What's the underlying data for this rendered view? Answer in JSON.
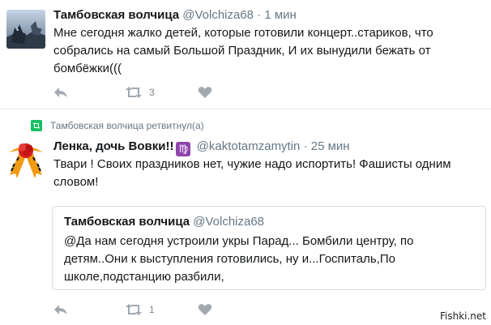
{
  "tweet1": {
    "name": "Тамбовская волчица",
    "handle": "@Volchiza68",
    "separator": "·",
    "time": "1 мин",
    "lines": [
      "Мне сегодня жалко детей, которые готовили концерт..стариков, что",
      "собрались на самый Большой Праздник, И их вынудили бежать от",
      "бомбёжки((("
    ],
    "retweets": "3"
  },
  "retweet_notice": "Тамбовская волчица ретвитнул(а)",
  "tweet2": {
    "name": "Ленка, дочь Вовки!!",
    "badge": "♍",
    "handle": "@kaktotamzamytin",
    "separator": "·",
    "time": "25 мин",
    "lines": [
      "Твари ! Своих праздников нет, чужие надо испортить! Фашисты одним",
      "словом!"
    ],
    "retweets": "1"
  },
  "quoted": {
    "name": "Тамбовская волчица",
    "handle": "@Volchiza68",
    "lines": [
      "@Да нам сегодня устроили укры Парад... Бомбили центру, по",
      "детям..Они к выступления готовились, ну и...Госпиталь,По",
      "школе,подстанцию разбили,"
    ]
  },
  "watermark": "Fishki.net",
  "colors": {
    "retweet_green": "#17bf63",
    "muted": "#657786",
    "badge": "#8e44ad"
  },
  "icons": [
    "reply-icon",
    "retweet-icon",
    "like-icon",
    "retweet-badge-icon",
    "virgo-badge-icon"
  ]
}
